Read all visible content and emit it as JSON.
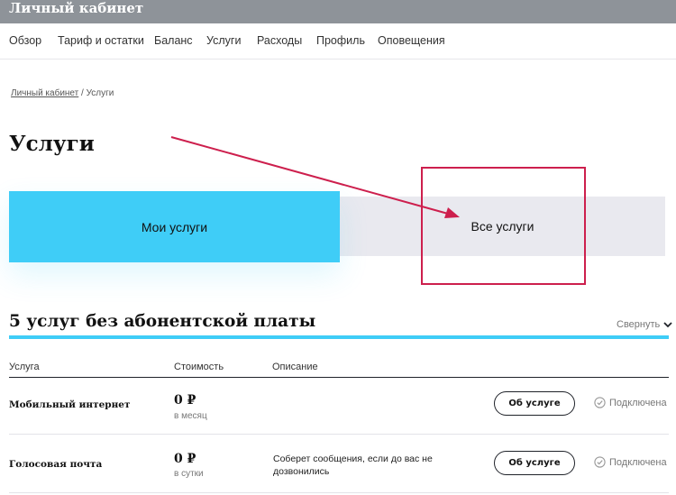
{
  "header": {
    "title": "Личный кабинет"
  },
  "nav": {
    "items": [
      {
        "label": "Обзор"
      },
      {
        "label": "Тариф и остатки"
      },
      {
        "label": "Баланс"
      },
      {
        "label": "Услуги"
      },
      {
        "label": "Расходы"
      },
      {
        "label": "Профиль"
      },
      {
        "label": "Оповещения"
      }
    ]
  },
  "breadcrumb": {
    "home": "Личный кабинет",
    "separator": " / ",
    "current": "Услуги"
  },
  "page": {
    "title": "Услуги"
  },
  "tabs": {
    "my_services": "Мои услуги",
    "all_services": "Все услуги",
    "active": "my_services"
  },
  "section": {
    "title": "5 услуг без абонентской платы",
    "collapse_label": "Свернуть"
  },
  "table": {
    "headers": {
      "service": "Услуга",
      "cost": "Стоимость",
      "description": "Описание"
    },
    "rows": [
      {
        "name": "Мобильный интернет",
        "price": "0 ₽",
        "period": "в месяц",
        "description": "",
        "button": "Об услуге",
        "status": "Подключена"
      },
      {
        "name": "Голосовая почта",
        "price": "0 ₽",
        "period": "в сутки",
        "description": "Соберет сообщения, если до вас не дозвонились",
        "button": "Об услуге",
        "status": "Подключена"
      }
    ]
  },
  "colors": {
    "accent": "#3fcdf7",
    "annotation": "#cd1f4d",
    "topbar": "#8e9399",
    "tab_inactive": "#e9e9ef"
  },
  "icons": {
    "collapse": "chevron-up-icon",
    "status": "check-circle-icon"
  }
}
